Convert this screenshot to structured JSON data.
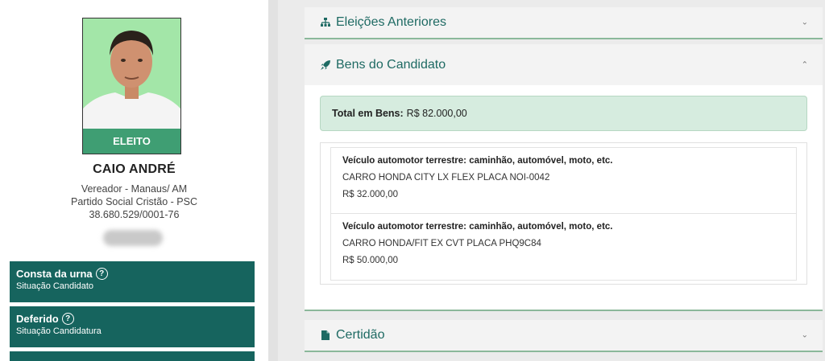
{
  "candidate": {
    "badge": "ELEITO",
    "name": "CAIO ANDRÉ",
    "role_location": "Vereador - Manaus/ AM",
    "party": "Partido Social Cristão - PSC",
    "cnpj": "38.680.529/0001-76"
  },
  "status_cards": [
    {
      "title": "Consta da urna",
      "subtitle": "Situação Candidato"
    },
    {
      "title": "Deferido",
      "subtitle": "Situação Candidatura"
    }
  ],
  "panels": {
    "previous_elections": {
      "title": "Eleições Anteriores",
      "icon": "sitemap-icon",
      "state": "collapsed"
    },
    "assets": {
      "title": "Bens do Candidato",
      "icon": "rocket-icon",
      "state": "expanded",
      "total_label": "Total em Bens:",
      "total_value": "R$ 82.000,00",
      "items": [
        {
          "type": "Veículo automotor terrestre: caminhão, automóvel, moto, etc.",
          "description": "CARRO HONDA CITY LX FLEX PLACA NOI-0042",
          "value": "R$ 32.000,00"
        },
        {
          "type": "Veículo automotor terrestre: caminhão, automóvel, moto, etc.",
          "description": "CARRO HONDA/FIT EX CVT PLACA PHQ9C84",
          "value": "R$ 50.000,00"
        }
      ]
    },
    "certificate": {
      "title": "Certidão",
      "icon": "file-icon",
      "state": "collapsed"
    }
  },
  "colors": {
    "accent": "#1e6a63",
    "card_bg": "#16645e",
    "badge_bg": "#3f9e73",
    "total_bg": "#d6ecdf"
  }
}
